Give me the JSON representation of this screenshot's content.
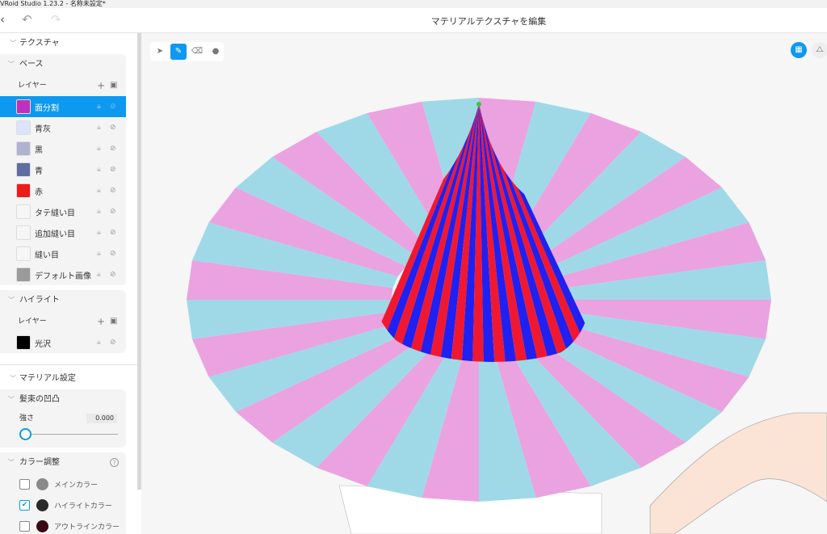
{
  "window": {
    "title": "VRoid Studio 1.23.2 - 名称未設定*"
  },
  "header": {
    "title": "マテリアルテクスチャを編集",
    "back": "‹",
    "undo": "↶",
    "redo": "↷"
  },
  "sidebar": {
    "texture_label": "テクスチャ",
    "base": {
      "label": "ベース",
      "layers_label": "レイヤー",
      "layers": [
        {
          "name": "面分割",
          "color": "#c030c0",
          "selected": true
        },
        {
          "name": "青灰",
          "color": "#dde3fb"
        },
        {
          "name": "黒",
          "color": "#b0b3cf"
        },
        {
          "name": "青",
          "color": "#5e6ea3"
        },
        {
          "name": "赤",
          "color": "#ee1b1b"
        },
        {
          "name": "タテ縫い目",
          "color": "#f6f6f6"
        },
        {
          "name": "追加縫い目",
          "color": "#f6f6f6"
        },
        {
          "name": "縫い目",
          "color": "#f6f6f6"
        },
        {
          "name": "デフォルト画像",
          "color": "#9a9a9a"
        }
      ]
    },
    "highlight": {
      "label": "ハイライト",
      "layers_label": "レイヤー",
      "layers": [
        {
          "name": "光沢",
          "color": "#000000"
        }
      ]
    },
    "material_label": "マテリアル設定",
    "bump": {
      "label": "髪束の凹凸",
      "strength_label": "強さ",
      "strength_value": "0.000",
      "strength": 0
    },
    "color_adjust": {
      "label": "カラー調整",
      "items": [
        {
          "label": "メインカラー",
          "checked": false,
          "color": "#8a8a8a"
        },
        {
          "label": "ハイライトカラー",
          "checked": true,
          "color": "#2a2a2a"
        },
        {
          "label": "アウトラインカラー",
          "checked": false,
          "color": "#3a0a14"
        }
      ]
    }
  },
  "accent": "#0d99f0"
}
